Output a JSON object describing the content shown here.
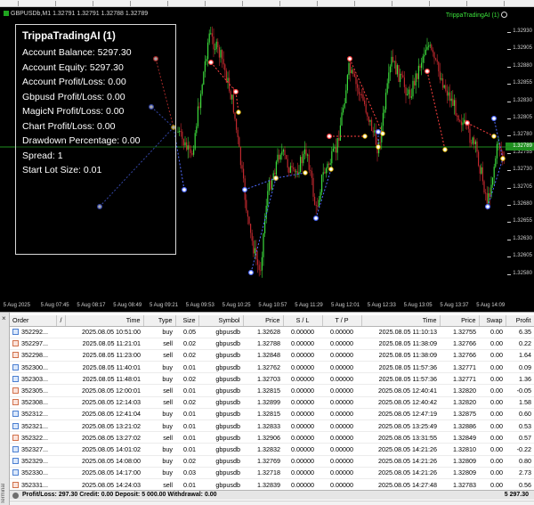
{
  "chart": {
    "symbol_label": "GBPUSDb,M1  1.32791 1.32791 1.32788 1.32789",
    "ea_label": "TrippaTradingAI (1)",
    "colors": {
      "up_candle": "#3cdc3c",
      "down_candle": "#c0282e",
      "background": "#000000",
      "current_price_line": "#1f8f1f",
      "buy_marker": "#4f6bff",
      "sell_marker": "#ff4040"
    },
    "price_axis": [
      "1.32930",
      "1.32905",
      "1.32880",
      "1.32855",
      "1.32830",
      "1.32805",
      "1.32780",
      "1.32755",
      "1.32730",
      "1.32705",
      "1.32680",
      "1.32655",
      "1.32630",
      "1.32605",
      "1.32580"
    ],
    "current_price": "1.32789",
    "time_axis": [
      "5 Aug 2025",
      "5 Aug 07:45",
      "5 Aug 08:17",
      "5 Aug 08:49",
      "5 Aug 09:21",
      "5 Aug 09:53",
      "5 Aug 10:25",
      "5 Aug 10:57",
      "5 Aug 11:29",
      "5 Aug 12:01",
      "5 Aug 12:33",
      "5 Aug 13:05",
      "5 Aug 13:37",
      "5 Aug 14:09"
    ]
  },
  "info_panel": {
    "title": "TrippaTradingAI (1)",
    "rows": [
      "Account Balance: 5297.30",
      "Account Equity: 5297.30",
      "Account Profit/Loss: 0.00",
      "Gbpusd Profit/Loss: 0.00",
      "MagicN Profit/Loss: 0.00",
      "Chart Profit/Loss: 0.00",
      "Drawdown Percentage: 0.00",
      "Spread: 1",
      "Start Lot Size: 0.01"
    ]
  },
  "terminal": {
    "sidebar_close": "×",
    "sidebar_label": "Terminal",
    "columns": [
      "Order",
      "/",
      "Time",
      "Type",
      "Size",
      "Symbol",
      "Price",
      "S / L",
      "T / P",
      "Time",
      "Price",
      "Swap",
      "Profit"
    ],
    "rows": [
      {
        "order": "352292...",
        "open_time": "2025.08.05 10:51:00",
        "type": "buy",
        "size": "0.05",
        "symbol": "gbpusdb",
        "open_price": "1.32628",
        "sl": "0.00000",
        "tp": "0.00000",
        "close_time": "2025.08.05 11:10:13",
        "close_price": "1.32755",
        "swap": "0.00",
        "profit": "6.35"
      },
      {
        "order": "352297...",
        "open_time": "2025.08.05 11:21:01",
        "type": "sell",
        "size": "0.02",
        "symbol": "gbpusdb",
        "open_price": "1.32788",
        "sl": "0.00000",
        "tp": "0.00000",
        "close_time": "2025.08.05 11:38:09",
        "close_price": "1.32766",
        "swap": "0.00",
        "profit": "0.22"
      },
      {
        "order": "352298...",
        "open_time": "2025.08.05 11:23:00",
        "type": "sell",
        "size": "0.02",
        "symbol": "gbpusdb",
        "open_price": "1.32848",
        "sl": "0.00000",
        "tp": "0.00000",
        "close_time": "2025.08.05 11:38:09",
        "close_price": "1.32766",
        "swap": "0.00",
        "profit": "1.64"
      },
      {
        "order": "352300...",
        "open_time": "2025.08.05 11:40:01",
        "type": "buy",
        "size": "0.01",
        "symbol": "gbpusdb",
        "open_price": "1.32762",
        "sl": "0.00000",
        "tp": "0.00000",
        "close_time": "2025.08.05 11:57:36",
        "close_price": "1.32771",
        "swap": "0.00",
        "profit": "0.09"
      },
      {
        "order": "352303...",
        "open_time": "2025.08.05 11:48:01",
        "type": "buy",
        "size": "0.02",
        "symbol": "gbpusdb",
        "open_price": "1.32703",
        "sl": "0.00000",
        "tp": "0.00000",
        "close_time": "2025.08.05 11:57:36",
        "close_price": "1.32771",
        "swap": "0.00",
        "profit": "1.36"
      },
      {
        "order": "352305...",
        "open_time": "2025.08.05 12:00:01",
        "type": "sell",
        "size": "0.01",
        "symbol": "gbpusdb",
        "open_price": "1.32815",
        "sl": "0.00000",
        "tp": "0.00000",
        "close_time": "2025.08.05 12:40:41",
        "close_price": "1.32820",
        "swap": "0.00",
        "profit": "-0.05"
      },
      {
        "order": "352308...",
        "open_time": "2025.08.05 12:14:03",
        "type": "sell",
        "size": "0.02",
        "symbol": "gbpusdb",
        "open_price": "1.32899",
        "sl": "0.00000",
        "tp": "0.00000",
        "close_time": "2025.08.05 12:40:42",
        "close_price": "1.32820",
        "swap": "0.00",
        "profit": "1.58"
      },
      {
        "order": "352312...",
        "open_time": "2025.08.05 12:41:04",
        "type": "buy",
        "size": "0.01",
        "symbol": "gbpusdb",
        "open_price": "1.32815",
        "sl": "0.00000",
        "tp": "0.00000",
        "close_time": "2025.08.05 12:47:19",
        "close_price": "1.32875",
        "swap": "0.00",
        "profit": "0.60"
      },
      {
        "order": "352321...",
        "open_time": "2025.08.05 13:21:02",
        "type": "buy",
        "size": "0.01",
        "symbol": "gbpusdb",
        "open_price": "1.32833",
        "sl": "0.00000",
        "tp": "0.00000",
        "close_time": "2025.08.05 13:25:49",
        "close_price": "1.32886",
        "swap": "0.00",
        "profit": "0.53"
      },
      {
        "order": "352322...",
        "open_time": "2025.08.05 13:27:02",
        "type": "sell",
        "size": "0.01",
        "symbol": "gbpusdb",
        "open_price": "1.32906",
        "sl": "0.00000",
        "tp": "0.00000",
        "close_time": "2025.08.05 13:31:55",
        "close_price": "1.32849",
        "swap": "0.00",
        "profit": "0.57"
      },
      {
        "order": "352327...",
        "open_time": "2025.08.05 14:01:02",
        "type": "buy",
        "size": "0.01",
        "symbol": "gbpusdb",
        "open_price": "1.32832",
        "sl": "0.00000",
        "tp": "0.00000",
        "close_time": "2025.08.05 14:21:26",
        "close_price": "1.32810",
        "swap": "0.00",
        "profit": "-0.22"
      },
      {
        "order": "352329...",
        "open_time": "2025.08.05 14:08:00",
        "type": "buy",
        "size": "0.02",
        "symbol": "gbpusdb",
        "open_price": "1.32769",
        "sl": "0.00000",
        "tp": "0.00000",
        "close_time": "2025.08.05 14:21:26",
        "close_price": "1.32809",
        "swap": "0.00",
        "profit": "0.80"
      },
      {
        "order": "352330...",
        "open_time": "2025.08.05 14:17:00",
        "type": "buy",
        "size": "0.03",
        "symbol": "gbpusdb",
        "open_price": "1.32718",
        "sl": "0.00000",
        "tp": "0.00000",
        "close_time": "2025.08.05 14:21:26",
        "close_price": "1.32809",
        "swap": "0.00",
        "profit": "2.73"
      },
      {
        "order": "352331...",
        "open_time": "2025.08.05 14:24:03",
        "type": "sell",
        "size": "0.01",
        "symbol": "gbpusdb",
        "open_price": "1.32839",
        "sl": "0.00000",
        "tp": "0.00000",
        "close_time": "2025.08.05 14:27:48",
        "close_price": "1.32783",
        "swap": "0.00",
        "profit": "0.56"
      }
    ],
    "summary": "Profit/Loss: 297.30  Credit: 0.00  Deposit: 5 000.00  Withdrawal: 0.00",
    "total": "5 297.30"
  }
}
